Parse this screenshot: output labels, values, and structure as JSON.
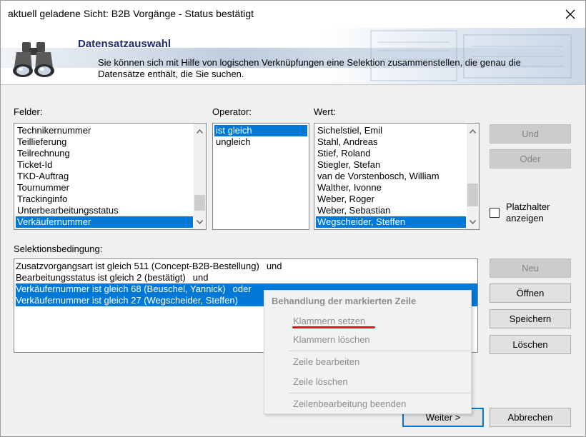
{
  "window": {
    "title": "aktuell geladene Sicht: B2B Vorgänge - Status bestätigt"
  },
  "banner": {
    "title": "Datensatzauswahl",
    "description": "Sie können sich mit Hilfe von logischen Verknüpfungen eine Selektion zusammenstellen, die genau die Datensätze enthält, die Sie suchen."
  },
  "fields": {
    "label": "Felder:",
    "items": [
      "Technikernummer",
      "Teillieferung",
      "Teilrechnung",
      "Ticket-Id",
      "TKD-Auftrag",
      "Tournummer",
      "Trackinginfo",
      "Unterbearbeitungsstatus",
      "Verkäufernummer"
    ],
    "selected": "Verkäufernummer"
  },
  "operator": {
    "label": "Operator:",
    "items": [
      "ist gleich",
      "ungleich"
    ],
    "selected": "ist gleich"
  },
  "value": {
    "label": "Wert:",
    "items": [
      "Sichelstiel, Emil",
      "Stahl, Andreas",
      "Stief, Roland",
      "Stiegler, Stefan",
      "van de Vorstenbosch, William",
      "Walther, Ivonne",
      "Weber, Roger",
      "Weber, Sebastian",
      "Wegscheider, Steffen"
    ],
    "selected": "Wegscheider, Steffen"
  },
  "side_buttons": {
    "und": "Und",
    "oder": "Oder"
  },
  "placeholder": {
    "label_line1": "Platzhalter",
    "label_line2": "anzeigen",
    "checked": false
  },
  "selection": {
    "label": "Selektionsbedingung:",
    "lines": [
      {
        "text": "Zusatzvorgangsart ist gleich 511 (Concept-B2B-Bestellung)",
        "conj": "und",
        "selected": false
      },
      {
        "text": "Bearbeitungsstatus ist gleich 2 (bestätigt)",
        "conj": "und",
        "selected": false
      },
      {
        "text": "Verkäufernummer ist gleich 68 (Beuschel, Yannick)",
        "conj": "oder",
        "selected": true
      },
      {
        "text": "Verkäufernummer ist gleich 27 (Wegscheider, Steffen)",
        "conj": "",
        "selected": true
      }
    ]
  },
  "right_buttons": {
    "neu": "Neu",
    "oeffnen": "Öffnen",
    "speichern": "Speichern",
    "loeschen": "Löschen"
  },
  "footer": {
    "weiter": "Weiter >",
    "abbrechen": "Abbrechen"
  },
  "context_menu": {
    "header": "Behandlung der markierten Zeile",
    "items": {
      "klammern_setzen": "Klammern setzen",
      "klammern_loeschen": "Klammern löschen",
      "zeile_bearbeiten": "Zeile bearbeiten",
      "zeile_loeschen": "Zeile löschen",
      "zeilenbearbeitung_beenden": "Zeilenbearbeitung beenden"
    }
  },
  "colors": {
    "selection": "#0078d7",
    "banner_title": "#1f2c72",
    "annotation_underline": "#e0141e"
  }
}
